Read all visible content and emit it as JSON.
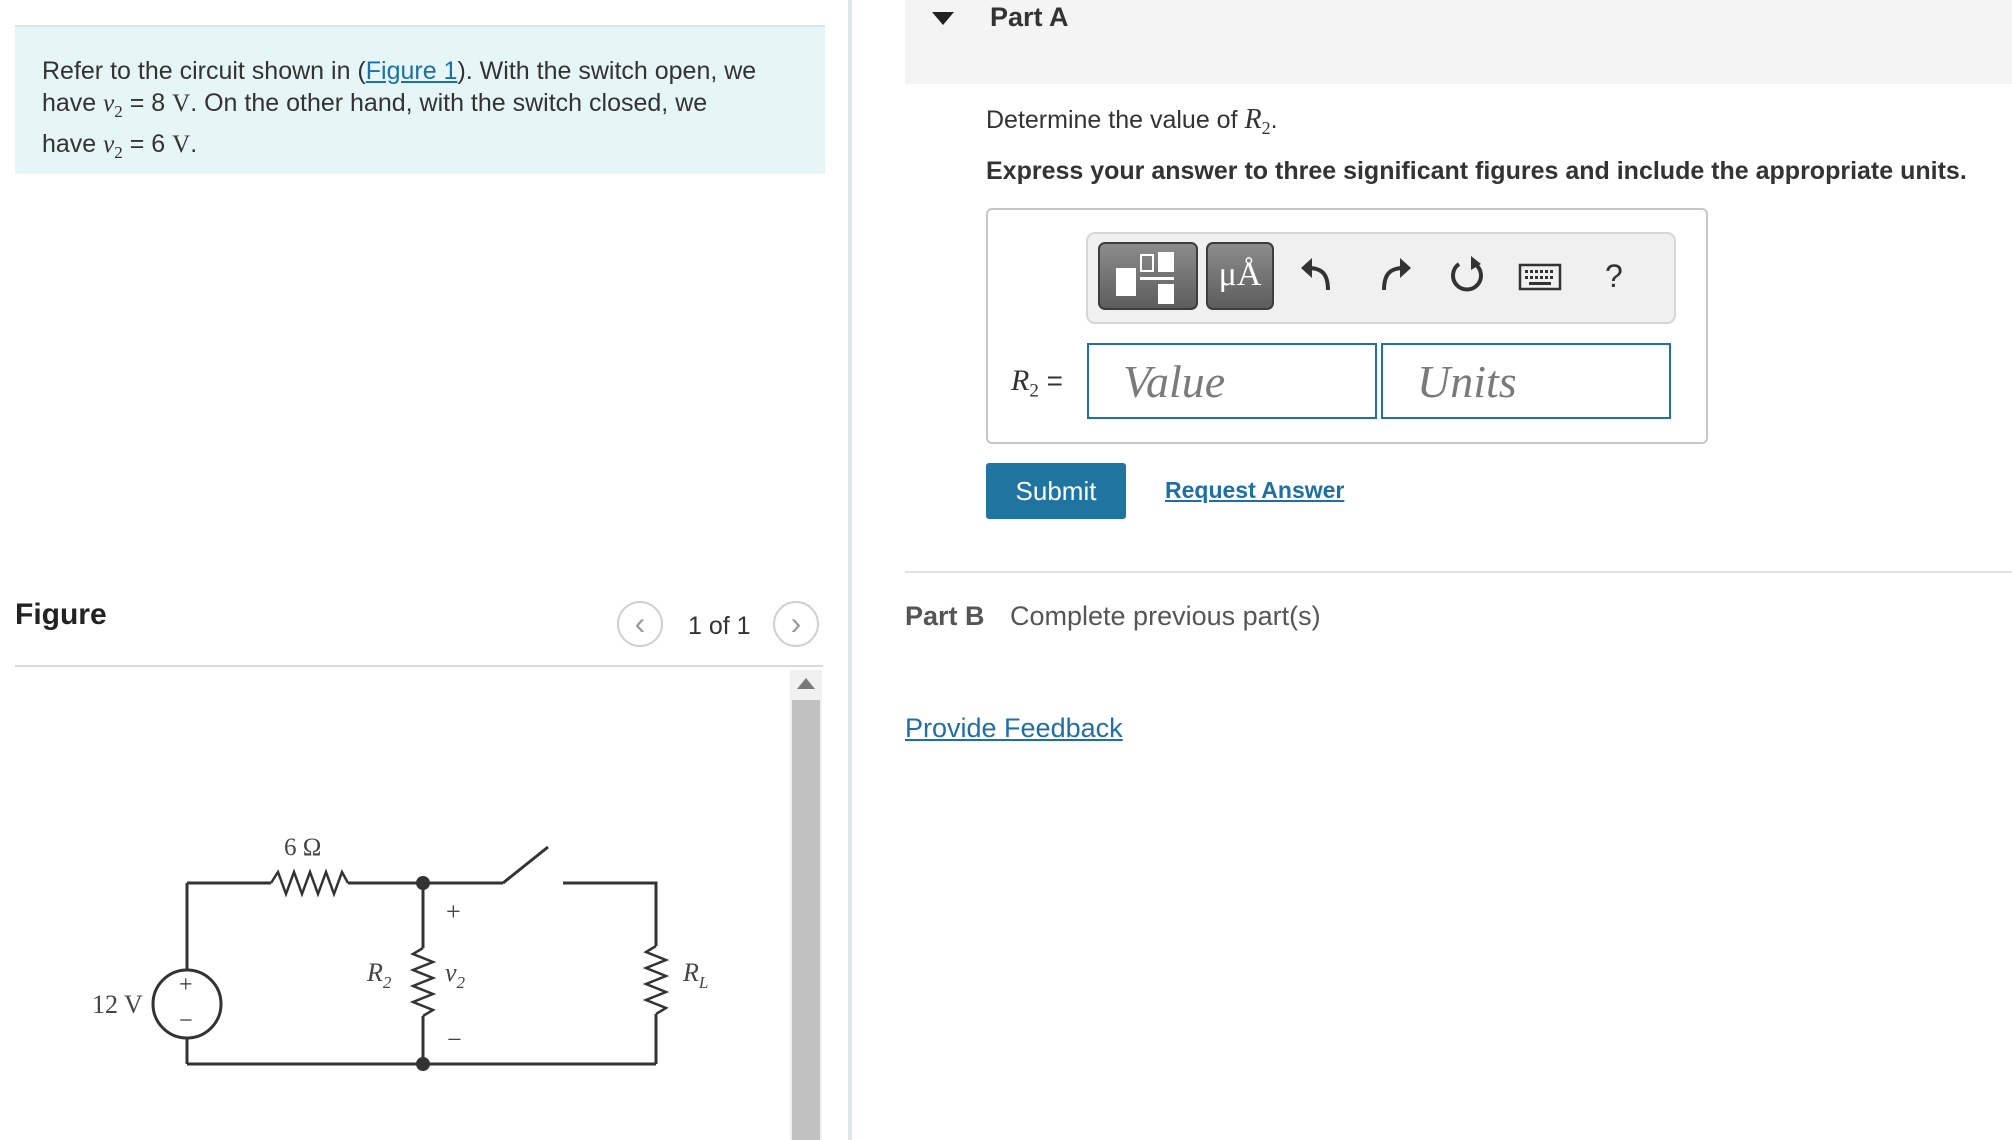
{
  "problem": {
    "line1_pre": "Refer to the circuit shown in (",
    "figure_link": "Figure 1",
    "line1_post": "). With the switch open, we",
    "have": "have",
    "v": "v",
    "sub": "2",
    "eq": " = ",
    "val_open": "8",
    "unit": "V",
    "line2_post": ". On the other hand, with the switch closed, we",
    "val_closed": "6",
    "period": "."
  },
  "figure": {
    "title": "Figure",
    "counter": "1 of 1",
    "prev_glyph": "‹",
    "next_glyph": "›",
    "circuit": {
      "source_label": "12 V",
      "source_plus": "+",
      "source_minus": "−",
      "resistor_top_label": "6 Ω",
      "r2_label": "R",
      "r2_sub": "2",
      "v2_label": "v",
      "v2_sub": "2",
      "v2_plus": "+",
      "v2_minus": "−",
      "rl_label": "R",
      "rl_sub": "L"
    }
  },
  "part_a": {
    "title": "Part A",
    "question_pre": "Determine the value of ",
    "question_var": "R",
    "question_sub": "2",
    "question_post": ".",
    "instruction": "Express your answer to three significant figures and include the appropriate units.",
    "toolbar": {
      "units_label": "μÅ",
      "help_label": "?",
      "icons": [
        "templates-icon",
        "units-icon",
        "undo-icon",
        "redo-icon",
        "reset-icon",
        "keyboard-icon",
        "help-icon"
      ]
    },
    "answer_label_var": "R",
    "answer_label_sub": "2",
    "answer_label_eq": " =",
    "value_placeholder": "Value",
    "units_placeholder": "Units",
    "submit_label": "Submit",
    "request_answer_label": "Request Answer"
  },
  "part_b": {
    "title": "Part B",
    "status": "Complete previous part(s)"
  },
  "feedback_label": "Provide Feedback",
  "colors": {
    "problem_bg": "#e6f5f5",
    "link": "#1d6fa4",
    "submit_bg": "#1f75a0",
    "input_border": "#2171a8"
  }
}
